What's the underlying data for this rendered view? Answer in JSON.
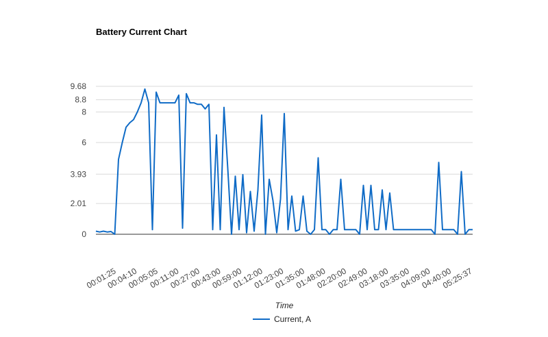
{
  "chart_data": {
    "type": "line",
    "title": "Battery Current Chart",
    "xlabel": "Time",
    "ylabel": "",
    "ylim": [
      0,
      9.68
    ],
    "y_ticks": [
      0,
      2.01,
      3.93,
      6,
      8,
      8.8,
      9.68
    ],
    "y_tick_labels": [
      "0",
      "2.01",
      "3.93",
      "6",
      "8",
      "8.8",
      "9.68"
    ],
    "x_tick_labels": [
      "00:01:25",
      "00:04:10",
      "00:05:05",
      "00:11:00",
      "00:27:00",
      "00:43:00",
      "00:59:00",
      "01:12:00",
      "01:23:00",
      "01:35:00",
      "01:48:00",
      "02:20:00",
      "02:49:00",
      "03:18:00",
      "03:35:00",
      "04:09:00",
      "04:40:00",
      "05:25:37"
    ],
    "grid": true,
    "legend": "bottom",
    "colors": {
      "series": "#0f6bc6",
      "grid": "#d9d9d9",
      "axis": "#333333"
    },
    "series": [
      {
        "name": "Current, A",
        "x": [
          0,
          0.01,
          0.02,
          0.03,
          0.04,
          0.05,
          0.06,
          0.07,
          0.08,
          0.09,
          0.1,
          0.11,
          0.12,
          0.13,
          0.14,
          0.15,
          0.16,
          0.17,
          0.18,
          0.19,
          0.2,
          0.21,
          0.22,
          0.23,
          0.24,
          0.25,
          0.26,
          0.27,
          0.28,
          0.29,
          0.3,
          0.31,
          0.32,
          0.33,
          0.34,
          0.35,
          0.36,
          0.37,
          0.38,
          0.39,
          0.4,
          0.41,
          0.42,
          0.43,
          0.44,
          0.45,
          0.46,
          0.47,
          0.48,
          0.49,
          0.5,
          0.51,
          0.52,
          0.53,
          0.54,
          0.55,
          0.56,
          0.57,
          0.58,
          0.59,
          0.6,
          0.61,
          0.62,
          0.63,
          0.64,
          0.65,
          0.66,
          0.67,
          0.68,
          0.69,
          0.7,
          0.71,
          0.72,
          0.73,
          0.74,
          0.75,
          0.76,
          0.77,
          0.78,
          0.79,
          0.8,
          0.81,
          0.82,
          0.83,
          0.84,
          0.85,
          0.86,
          0.87,
          0.88,
          0.89,
          0.9,
          0.91,
          0.92,
          0.93,
          0.94,
          0.95,
          0.96,
          0.97,
          0.98,
          0.99,
          1.0
        ],
        "y": [
          0.2,
          0.15,
          0.2,
          0.15,
          0.18,
          0.0,
          4.9,
          6.0,
          7.0,
          7.3,
          7.5,
          8.0,
          8.6,
          9.5,
          8.6,
          0.3,
          9.3,
          8.6,
          8.6,
          8.6,
          8.6,
          8.6,
          9.1,
          0.4,
          9.2,
          8.6,
          8.6,
          8.5,
          8.5,
          8.2,
          8.5,
          0.3,
          6.5,
          0.3,
          8.3,
          4.3,
          0.0,
          3.8,
          0.3,
          3.9,
          0.1,
          2.8,
          0.2,
          2.9,
          7.8,
          0.0,
          3.6,
          2.2,
          0.1,
          2.3,
          7.9,
          0.3,
          2.5,
          0.2,
          0.3,
          2.5,
          0.2,
          0.0,
          0.3,
          5.0,
          0.3,
          0.3,
          0.0,
          0.3,
          0.3,
          3.6,
          0.3,
          0.3,
          0.3,
          0.3,
          0.0,
          3.2,
          0.3,
          3.2,
          0.3,
          0.3,
          2.9,
          0.3,
          2.7,
          0.3,
          0.3,
          0.3,
          0.3,
          0.3,
          0.3,
          0.3,
          0.3,
          0.3,
          0.3,
          0.3,
          0.0,
          4.7,
          0.3,
          0.3,
          0.3,
          0.3,
          0.0,
          4.1,
          0.0,
          0.3,
          0.3
        ]
      }
    ]
  }
}
